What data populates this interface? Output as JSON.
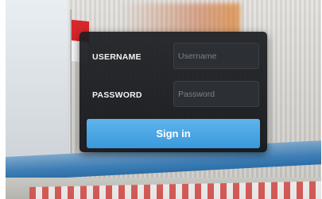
{
  "login": {
    "username_label": "USERNAME",
    "username_placeholder": "Username",
    "username_value": "",
    "password_label": "PASSWORD",
    "password_placeholder": "Password",
    "password_value": "",
    "sign_in_label": "Sign in"
  },
  "colors": {
    "panel_background": "#1c1e22",
    "input_background": "#2c2f34",
    "button_background": "#4aa6e4",
    "label_text": "#f2f2f2"
  }
}
